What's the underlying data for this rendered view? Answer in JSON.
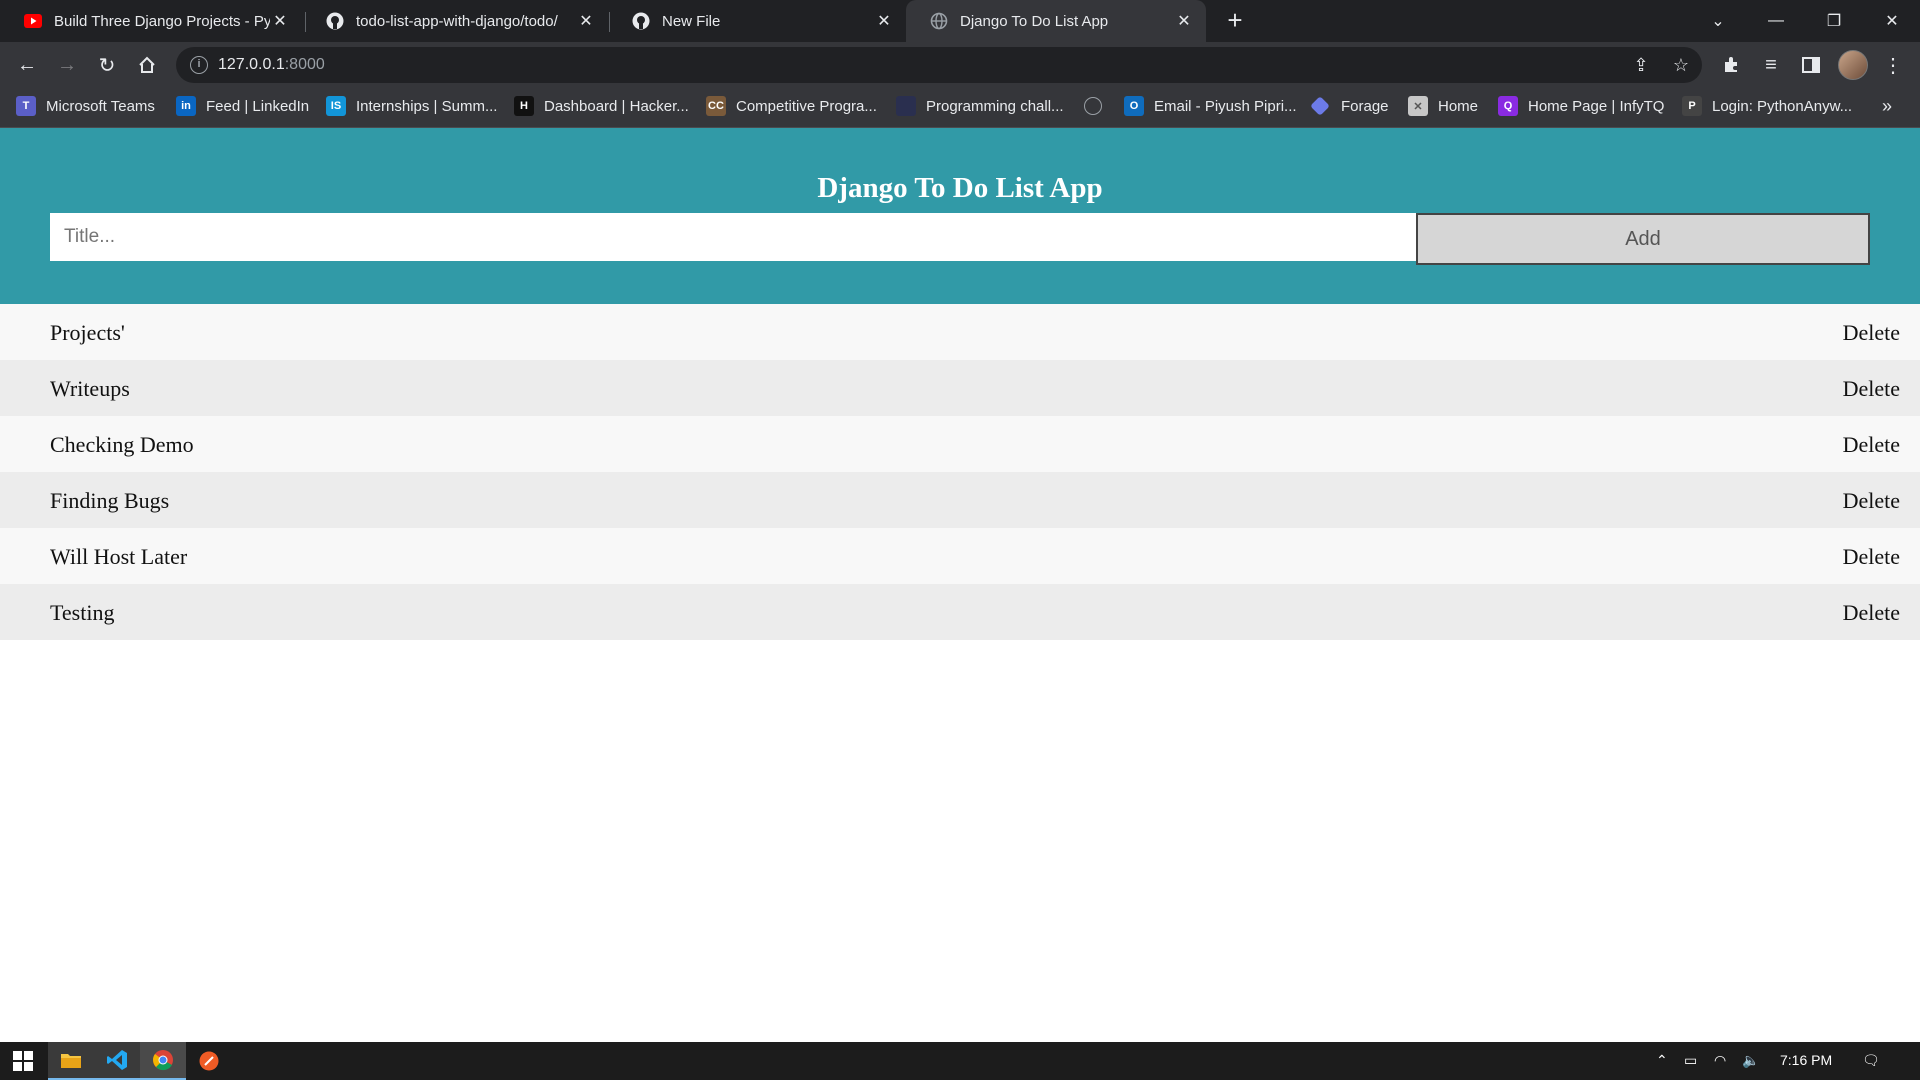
{
  "browser": {
    "tabs": [
      {
        "title": "Build Three Django Projects - Pyt",
        "icon": "youtube-icon",
        "active": false
      },
      {
        "title": "todo-list-app-with-django/todo/",
        "icon": "github-icon",
        "active": false
      },
      {
        "title": "New File",
        "icon": "github-icon",
        "active": false
      },
      {
        "title": "Django To Do List App",
        "icon": "globe-icon",
        "active": true
      }
    ],
    "url_host": "127.0.0.1",
    "url_port": ":8000",
    "bookmarks": [
      {
        "label": "Microsoft Teams",
        "icon": "teams-icon",
        "color": "#5b5fc7"
      },
      {
        "label": "Feed | LinkedIn",
        "icon": "linkedin-icon",
        "color": "#0a66c2"
      },
      {
        "label": "Internships | Summ...",
        "icon": "internshala-icon",
        "color": "#1295d8"
      },
      {
        "label": "Dashboard | Hacker...",
        "icon": "hackerrank-icon",
        "color": "#111111"
      },
      {
        "label": "Competitive Progra...",
        "icon": "codechef-icon",
        "color": "#7a5a3a"
      },
      {
        "label": "Programming chall...",
        "icon": "challenge-icon",
        "color": "#2a2f4f"
      },
      {
        "label": "",
        "icon": "globe-icon",
        "color": "#9aa0a6"
      },
      {
        "label": "Email - Piyush Pipri...",
        "icon": "outlook-icon",
        "color": "#0f6cbd"
      },
      {
        "label": "Forage",
        "icon": "forage-icon",
        "color": "#6c7be8"
      },
      {
        "label": "Home",
        "icon": "home-bookmark-icon",
        "color": "#c7c7c7"
      },
      {
        "label": "Home Page | InfyTQ",
        "icon": "infytq-icon",
        "color": "#8a2be2"
      },
      {
        "label": "Login: PythonAnyw...",
        "icon": "pythonanywhere-icon",
        "color": "#444444"
      }
    ]
  },
  "app": {
    "title": "Django To Do List App",
    "input_placeholder": "Title...",
    "add_label": "Add",
    "delete_label": "Delete",
    "header_color": "#319aa7",
    "todos": [
      "Projects'",
      "Writeups",
      "Checking Demo",
      "Finding Bugs",
      "Will Host Later",
      "Testing"
    ]
  },
  "taskbar": {
    "time": "7:16 PM",
    "apps": [
      "file-explorer-icon",
      "vscode-icon",
      "chrome-icon",
      "postman-icon"
    ]
  }
}
